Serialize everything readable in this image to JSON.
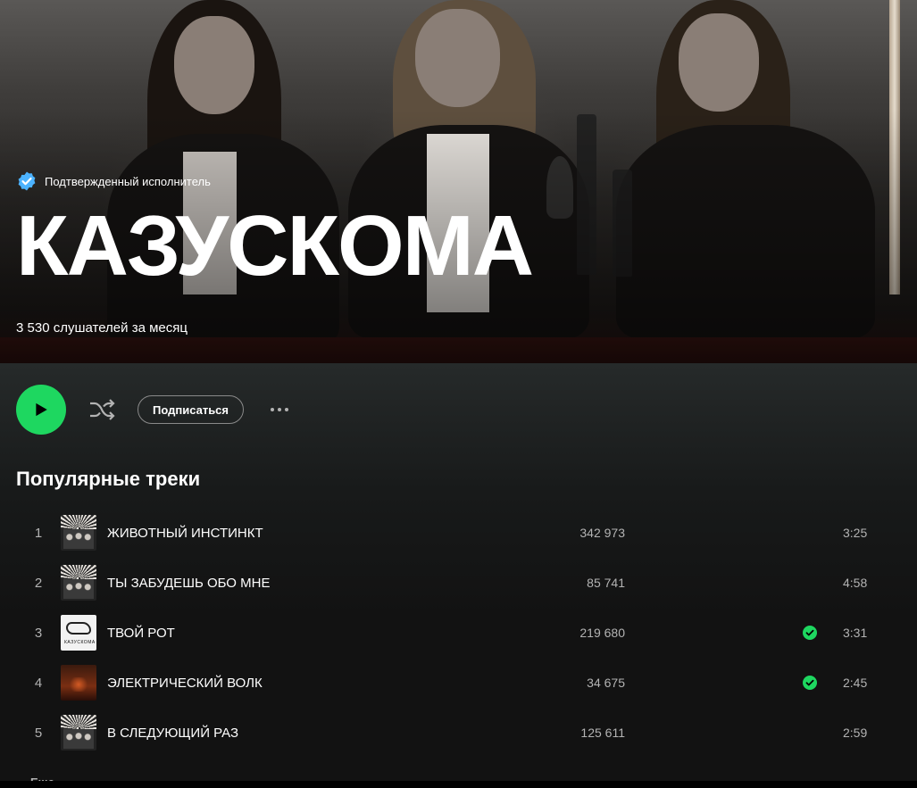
{
  "artist": {
    "verified_label": "Подтвержденный исполнитель",
    "name": "КАЗУСКОМА",
    "monthly_listeners": "3 530 слушателей за месяц"
  },
  "actions": {
    "follow_label": "Подписаться"
  },
  "section_title": "Популярные треки",
  "tracks": [
    {
      "num": "1",
      "title": "ЖИВОТНЫЙ ИНСТИНКТ",
      "plays": "342 973",
      "duration": "3:25",
      "saved": false
    },
    {
      "num": "2",
      "title": "ТЫ ЗАБУДЕШЬ ОБО МНЕ",
      "plays": "85 741",
      "duration": "4:58",
      "saved": false
    },
    {
      "num": "3",
      "title": "ТВОЙ РОТ",
      "plays": "219 680",
      "duration": "3:31",
      "saved": true
    },
    {
      "num": "4",
      "title": "ЭЛЕКТРИЧЕСКИЙ ВОЛК",
      "plays": "34 675",
      "duration": "2:45",
      "saved": true
    },
    {
      "num": "5",
      "title": "В СЛЕДУЮЩИЙ РАЗ",
      "plays": "125 611",
      "duration": "2:59",
      "saved": false
    }
  ],
  "cover_text": "КАЗУСКОМА",
  "more_label": "Еще",
  "colors": {
    "accent": "#1ed760",
    "verified": "#4cb3ff",
    "background": "#121212"
  },
  "icons": {
    "play": "play-icon",
    "shuffle": "shuffle-icon",
    "more": "more-icon",
    "verified": "verified-badge-icon",
    "saved": "check-circle-icon"
  }
}
